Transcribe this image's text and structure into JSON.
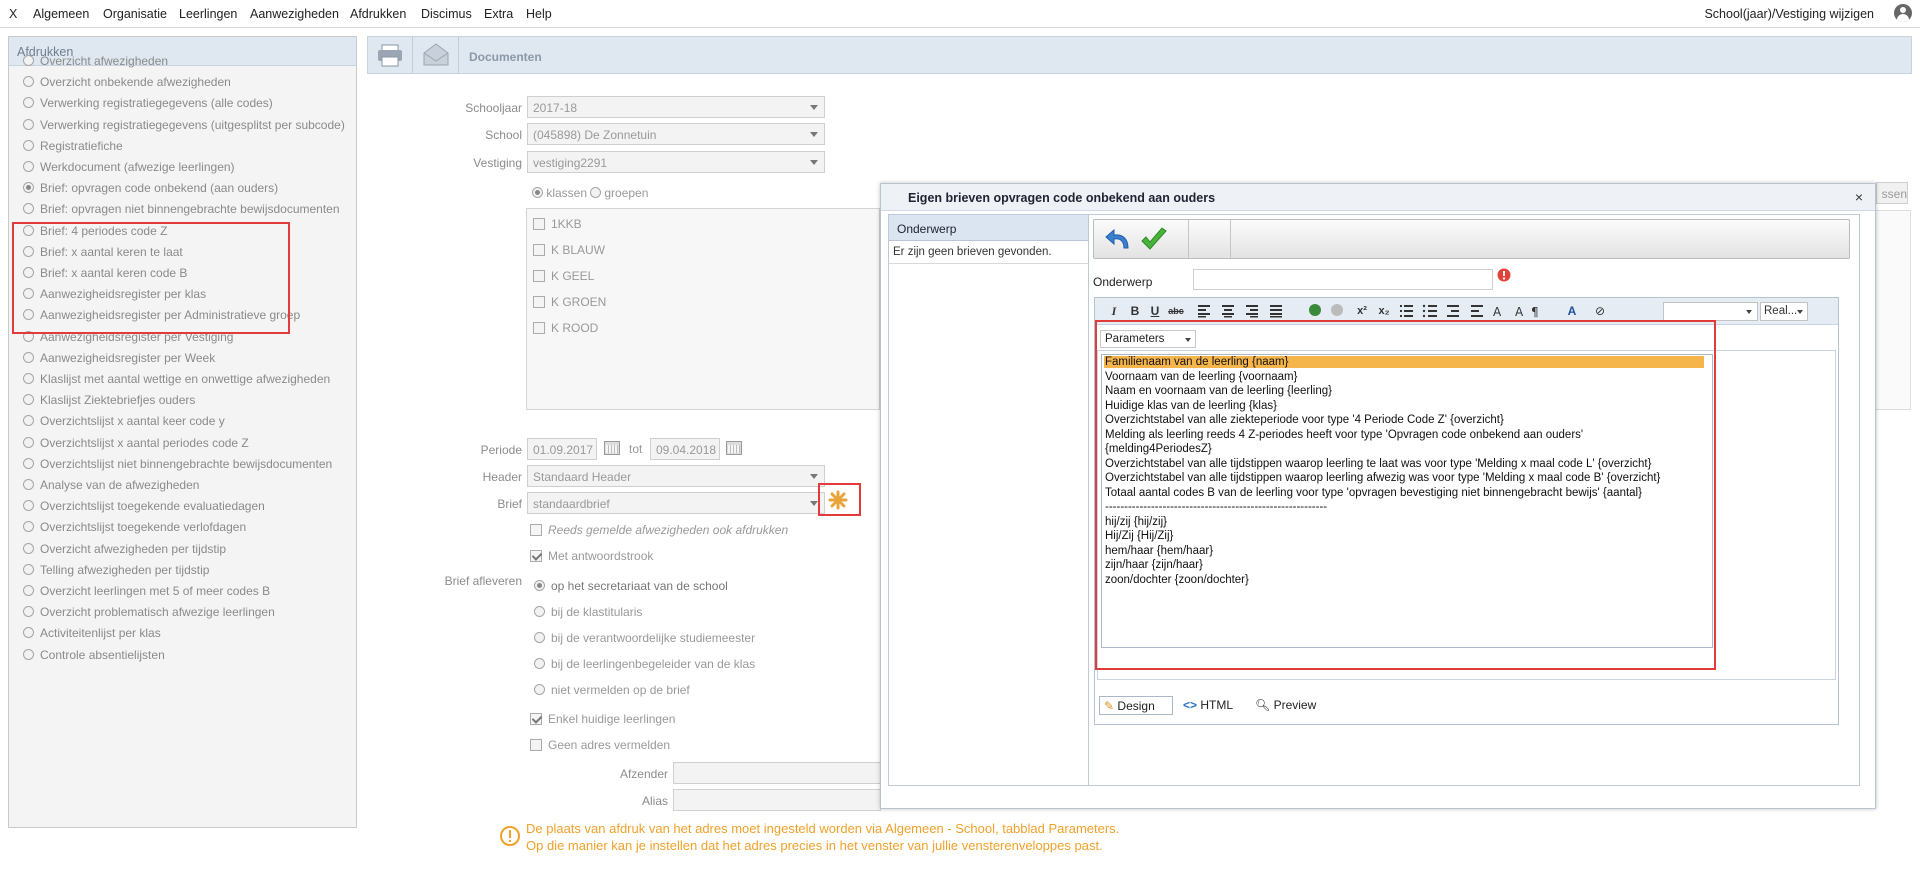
{
  "menu": {
    "items": [
      "X",
      "Algemeen",
      "Organisatie",
      "Leerlingen",
      "Aanwezigheden",
      "Afdrukken",
      "Discimus",
      "Extra",
      "Help"
    ],
    "right": "School(jaar)/Vestiging wijzigen"
  },
  "left": {
    "header": "Afdrukken",
    "items": [
      "Overzicht afwezigheden",
      "Overzicht onbekende afwezigheden",
      "Verwerking registratiegegevens (alle codes)",
      "Verwerking registratiegegevens (uitgesplitst per subcode)",
      "Registratiefiche",
      "Werkdocument (afwezige leerlingen)",
      "Brief: opvragen code onbekend (aan ouders)",
      "Brief: opvragen niet binnengebrachte bewijsdocumenten",
      "Brief: 4 periodes code Z",
      "Brief: x aantal keren te laat",
      "Brief: x aantal keren code B",
      "Aanwezigheidsregister per klas",
      "Aanwezigheidsregister per Administratieve groep",
      "Aanwezigheidsregister per Vestiging",
      "Aanwezigheidsregister per Week",
      "Klaslijst met aantal wettige en onwettige afwezigheden",
      "Klaslijst Ziektebriefjes ouders",
      "Overzichtslijst x aantal keer code y",
      "Overzichtslijst x aantal periodes code Z",
      "Overzichtslijst niet binnengebrachte bewijsdocumenten",
      "Analyse van de afwezigheden",
      "Overzichtslijst toegekende evaluatiedagen",
      "Overzichtslijst toegekende verlofdagen",
      "Overzicht afwezigheden per tijdstip",
      "Telling afwezigheden per tijdstip",
      "Overzicht leerlingen met 5 of meer codes B",
      "Overzicht problematisch afwezige leerlingen",
      "Activiteitenlijst per klas",
      "Controle absentielijsten"
    ]
  },
  "main": {
    "toolbar_title": "Documenten",
    "schooljaar_label": "Schooljaar",
    "schooljaar_value": "2017-18",
    "school_label": "School",
    "school_value": "(045898) De Zonnetuin",
    "vestiging_label": "Vestiging",
    "vestiging_value": "vestiging2291",
    "radio_klassen": "klassen",
    "radio_groepen": "groepen",
    "classes": [
      "1KKB",
      "K BLAUW",
      "K GEEL",
      "K GROEN",
      "K ROOD"
    ],
    "periode_label": "Periode",
    "periode_from": "01.09.2017",
    "tot_label": "tot",
    "periode_to": "09.04.2018",
    "header_label": "Header",
    "header_value": "Standaard Header",
    "brief_label": "Brief",
    "brief_value": "standaardbrief",
    "chk_reeds": "Reeds gemelde afwezigheden ook afdrukken",
    "chk_antwoord": "Met antwoordstrook",
    "afleveren_label": "Brief afleveren",
    "afleveren_options": [
      "op het secretariaat van de school",
      "bij de klastitularis",
      "bij de verantwoordelijke studiemeester",
      "bij de leerlingenbegeleider van de klas",
      "niet vermelden op de brief"
    ],
    "chk_enkel": "Enkel huidige leerlingen",
    "chk_geen": "Geen adres vermelden",
    "afzender_label": "Afzender",
    "alias_label": "Alias",
    "hint_line1": "De plaats van afdruk van het adres moet ingesteld worden via Algemeen - School, tabblad Parameters.",
    "hint_line2": "Op die manier kan je instellen dat het adres precies in het venster van jullie vensterenveloppes past.",
    "behind_button": "ssen"
  },
  "dialog": {
    "title": "Eigen brieven opvragen code onbekend aan ouders",
    "close": "×",
    "col_header": "Onderwerp",
    "empty_text": "Er zijn geen brieven gevonden.",
    "onderwerp_label": "Onderwerp",
    "onderwerp_value": "",
    "font_size_value": "",
    "font_name_value": "Real...",
    "params_select": "Parameters",
    "params": [
      "Familienaam van de leerling {naam}",
      "Voornaam van de leerling {voornaam}",
      "Naam en voornaam van de leerling {leerling}",
      "Huidige klas van de leerling {klas}",
      "Overzichtstabel van alle ziekteperiode voor type '4 Periode Code Z' {overzicht}",
      "Melding als leerling reeds 4 Z-periodes heeft voor type 'Opvragen code onbekend aan ouders'",
      "{melding4PeriodesZ}",
      "Overzichtstabel van alle tijdstippen waarop leerling te laat was voor type 'Melding x maal code L' {overzicht}",
      "Overzichtstabel van alle tijdstippen waarop leerling afwezig was voor type 'Melding x maal code B' {overzicht}",
      "Totaal aantal codes B van de leerling voor type 'opvragen bevestiging niet binnengebracht bewijs' {aantal}",
      "----------------------------------------------------------",
      "hij/zij {hij/zij}",
      "Hij/Zij {Hij/Zij}",
      "hem/haar {hem/haar}",
      "zijn/haar {zijn/haar}",
      "zoon/dochter {zoon/dochter}"
    ],
    "tabs": [
      "Design",
      "HTML",
      "Preview"
    ]
  },
  "colors": {
    "highlight": "#f5b54a",
    "red_box": "#e23b3b",
    "hint": "#f0a12a"
  }
}
